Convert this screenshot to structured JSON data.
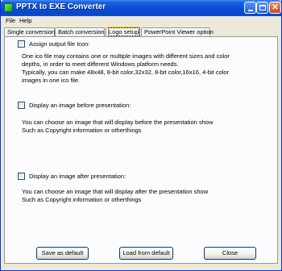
{
  "window": {
    "title": "PPTX to EXE Converter",
    "controls": {
      "minimize": "_",
      "maximize": "□",
      "close": "✕"
    }
  },
  "menu": [
    {
      "label": "File"
    },
    {
      "label": "Help"
    }
  ],
  "tabs": [
    {
      "label": "Single conversion",
      "active": false
    },
    {
      "label": "Batch conversion",
      "active": false
    },
    {
      "label": "Logo setup",
      "active": true
    },
    {
      "label": "PowerPoint Viewer option",
      "active": false
    }
  ],
  "sections": {
    "icon": {
      "checkbox_label": "Assign output file Icon:",
      "checked": false,
      "description": [
        "One ico file may contains one or multiple images with different sizes and color",
        "depths, in order to meet different Windows platform needs.",
        "Typically, you can make 48x48, 8-bit color,32x32, 8-bit color,16x16, 4-bit color",
        "images in one ico file."
      ]
    },
    "before": {
      "checkbox_label": "Display an image before presentation:",
      "checked": false,
      "description": [
        "You can choose an image that will display before the presentation show",
        "Such as Copyright information or otherthings"
      ]
    },
    "after": {
      "checkbox_label": "Display an image after presentation:",
      "checked": false,
      "description": [
        "You can choose an image that will display after the presentation show",
        "Such as Copyright information or otherthings"
      ]
    }
  },
  "buttons": {
    "save_default": "Save as default",
    "load_default": "Load from default",
    "close": "Close"
  }
}
